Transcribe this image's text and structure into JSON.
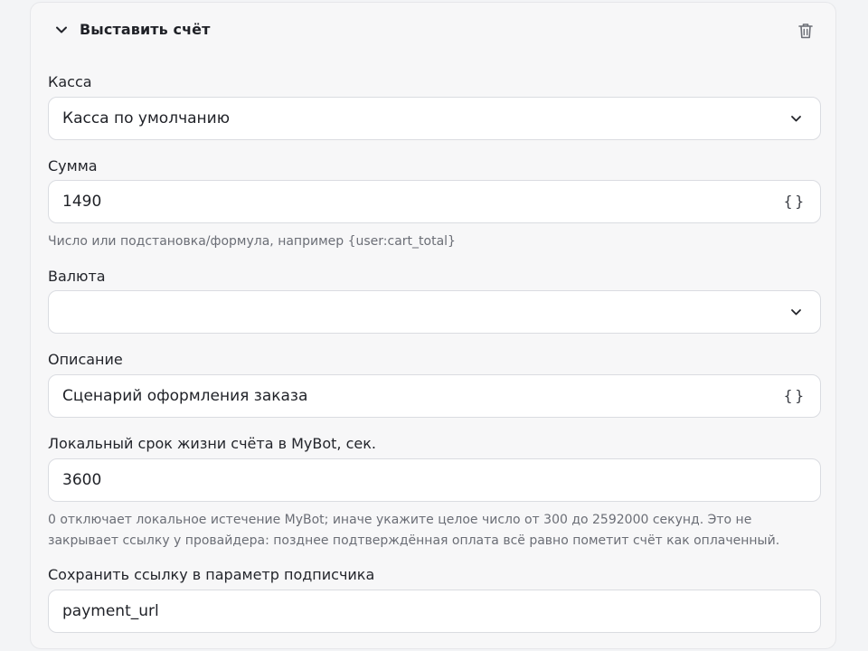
{
  "block": {
    "title": "Выставить счёт"
  },
  "fields": {
    "kassa": {
      "label": "Касса",
      "value": "Касса по умолчанию"
    },
    "summa": {
      "label": "Сумма",
      "value": "1490",
      "placeholder_button": "{}",
      "hint": "Число или подстановка/формула, например {user:cart_total}"
    },
    "valuta": {
      "label": "Валюта",
      "value": ""
    },
    "opisanie": {
      "label": "Описание",
      "value": "Сценарий оформления заказа",
      "placeholder_button": "{}"
    },
    "ttl": {
      "label": "Локальный срок жизни счёта в MyBot, сек.",
      "value": "3600",
      "hint_line1": "0 отключает локальное истечение MyBot; иначе укажите целое число от 300 до 2592000 секунд. Это не",
      "hint_line2": "закрывает ссылку у провайдера: позднее подтверждённая оплата всё равно пометит счёт как оплаченный."
    },
    "save_param": {
      "label": "Сохранить ссылку в параметр подписчика",
      "value": "payment_url"
    }
  },
  "icons": {
    "collapse": "chevron-down-icon",
    "delete": "trash-icon",
    "dropdown": "chevron-down-icon",
    "variable": "braces-icon"
  }
}
